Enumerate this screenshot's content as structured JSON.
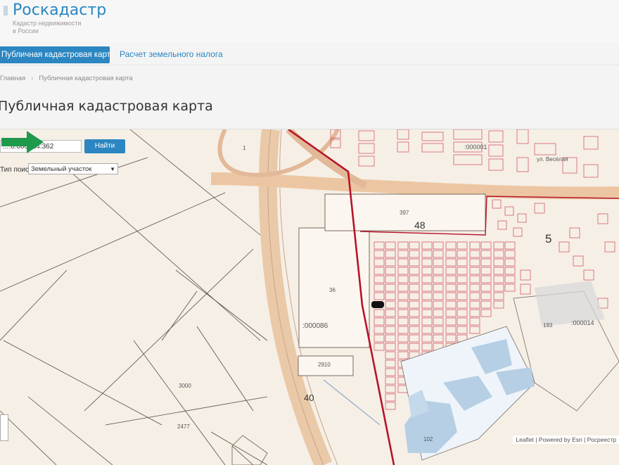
{
  "header": {
    "brand": "Роскадастр",
    "tagline_line1": "Кадастр недвижимости",
    "tagline_line2": "в России"
  },
  "nav": {
    "tabs": [
      {
        "label": "Публичная кадастровая карта",
        "active": true
      },
      {
        "label": "Расчет земельного налога",
        "active": false
      }
    ]
  },
  "breadcrumb": {
    "items": [
      "Главная",
      "Публичная кадастровая карта"
    ]
  },
  "page": {
    "title": "Публичная кадастровая карта"
  },
  "search": {
    "value": "...:0:000014:362",
    "button_label": "Найти",
    "type_label": "Тип поиска:",
    "type_value": "Земельный участок"
  },
  "map": {
    "block_labels": {
      "n48": "48",
      "n5": "5",
      "n40": "40",
      "q000086": ":000086",
      "q000014": ":000014",
      "q000001": ":000001",
      "p36": "36",
      "p2910": "2910",
      "p3000": "3000",
      "p2477": "2477",
      "p397": "397",
      "p1": "1",
      "p102": "102",
      "p193": "193",
      "street": "ул. Весёлая"
    },
    "attribution": "Leaflet | Powered by Esri | Росреестр",
    "accent_color": "#2b86c1",
    "arrow_color": "#1e9a4c",
    "boundary_color": "#b8142a"
  }
}
